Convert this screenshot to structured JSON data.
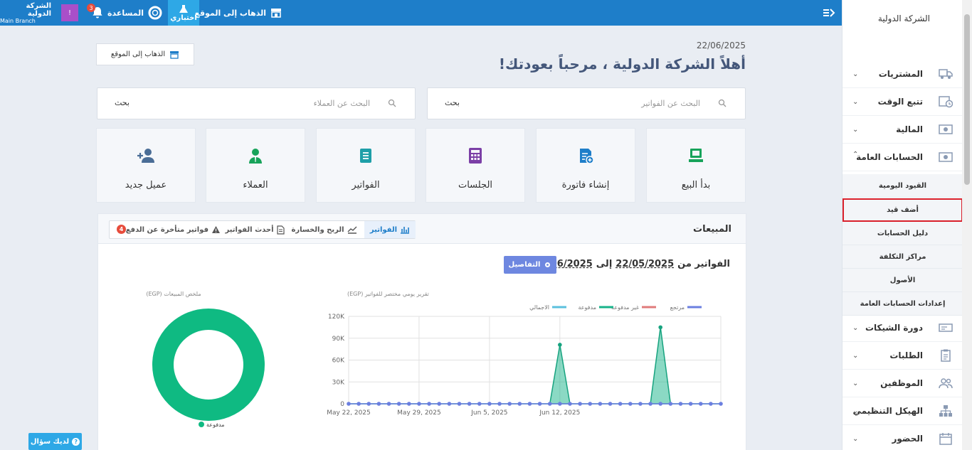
{
  "topbar": {
    "company_name": "الشركة الدولية",
    "branch": "Main Branch",
    "user_badge": "!",
    "notification_count": "3",
    "help_label": "المساعدة",
    "test_label": "اختباري",
    "go_to_site_label": "الذهاب إلى الموقع"
  },
  "sidebar": {
    "company": "الشركة الدولية",
    "items": [
      {
        "label": "المشتريات",
        "icon": "truck-icon"
      },
      {
        "label": "تتبع الوقت",
        "icon": "clock-calendar-icon"
      },
      {
        "label": "المالية",
        "icon": "money-icon"
      },
      {
        "label": "الحسابات العامة",
        "icon": "money-icon"
      }
    ],
    "subitems": [
      {
        "label": "القيود اليومية"
      },
      {
        "label": "أضف قيد"
      },
      {
        "label": "دليل الحسابات"
      },
      {
        "label": "مراكز التكلفة"
      },
      {
        "label": "الأصول"
      },
      {
        "label": "إعدادات الحسابات العامة"
      }
    ],
    "items_bottom": [
      {
        "label": "دورة الشيكات",
        "icon": "check-icon"
      },
      {
        "label": "الطلبات",
        "icon": "clipboard-icon"
      },
      {
        "label": "الموظفين",
        "icon": "users-icon"
      },
      {
        "label": "الهيكل التنظيمي",
        "icon": "sitemap-icon"
      },
      {
        "label": "الحضور",
        "icon": "calendar-icon"
      }
    ]
  },
  "header": {
    "date": "22/06/2025",
    "welcome": "أهلاً الشركة الدولية ، مرحباً بعودتك!",
    "go_to_site_button": "الذهاب إلى الموقع"
  },
  "search": {
    "invoices_placeholder": "البحث عن الفواتير",
    "clients_placeholder": "البحث عن العملاء",
    "search_button": "بحث"
  },
  "tiles": [
    {
      "label": "بدأ البيع",
      "icon": "pos-icon",
      "color": "#17a35a"
    },
    {
      "label": "إنشاء فاتورة",
      "icon": "add-invoice-icon",
      "color": "#1e7ec9"
    },
    {
      "label": "الجلسات",
      "icon": "calculator-icon",
      "color": "#7b3fa6"
    },
    {
      "label": "الفواتير",
      "icon": "invoice-icon",
      "color": "#1e9fa8"
    },
    {
      "label": "العملاء",
      "icon": "client-icon",
      "color": "#17a35a"
    },
    {
      "label": "عميل جديد",
      "icon": "add-user-icon",
      "color": "#4a6d96"
    }
  ],
  "sales": {
    "title": "المبيعات",
    "tabs": [
      {
        "label": "الفواتير",
        "icon": "bar-chart-icon",
        "active": true
      },
      {
        "label": "الربح والخسارة",
        "icon": "line-chart-icon",
        "active": false
      },
      {
        "label": "أحدث الفواتير",
        "icon": "document-icon",
        "active": false
      },
      {
        "label": "فواتير متأخرة عن الدفع",
        "icon": "warning-icon",
        "active": false,
        "badge": "4"
      }
    ],
    "range_title": "الفواتير من",
    "range_from": "22/05/2025",
    "range_to_word": "إلى",
    "range_to": "22/06/2025",
    "details_button": "التفاصيل"
  },
  "chart_data": [
    {
      "type": "line",
      "title": "(EGP) تقرير يومي مختصر للفواتير",
      "legend": [
        "مرتجع",
        "غير مدفوعة",
        "مدفوعة",
        "الاجمالي"
      ],
      "legend_colors": [
        "#6b7fe0",
        "#e07b7b",
        "#17b38a",
        "#5bc0de"
      ],
      "y_ticks": [
        "0",
        "30K",
        "60K",
        "90K",
        "120K"
      ],
      "x_ticks": [
        "May 22, 2025",
        "May 29, 2025",
        "Jun 5, 2025",
        "Jun 12, 2025"
      ],
      "ylim": [
        0,
        120000
      ],
      "series": [
        {
          "name": "مدفوعة",
          "points": [
            [
              0,
              0
            ],
            [
              1,
              0
            ],
            [
              2,
              0
            ],
            [
              3,
              0
            ],
            [
              4,
              0
            ],
            [
              5,
              0
            ],
            [
              6,
              0
            ],
            [
              7,
              0
            ],
            [
              8,
              0
            ],
            [
              9,
              0
            ],
            [
              10,
              0
            ],
            [
              11,
              0
            ],
            [
              12,
              0
            ],
            [
              13,
              0
            ],
            [
              14,
              0
            ],
            [
              15,
              0
            ],
            [
              16,
              0
            ],
            [
              17,
              0
            ],
            [
              18,
              0
            ],
            [
              19,
              0
            ],
            [
              20,
              0
            ],
            [
              21,
              81000
            ],
            [
              22,
              0
            ],
            [
              23,
              0
            ],
            [
              24,
              0
            ],
            [
              25,
              0
            ],
            [
              26,
              0
            ],
            [
              27,
              0
            ],
            [
              28,
              0
            ],
            [
              29,
              0
            ],
            [
              30,
              0
            ],
            [
              31,
              105000
            ],
            [
              32,
              0
            ],
            [
              33,
              0
            ],
            [
              34,
              0
            ],
            [
              35,
              0
            ],
            [
              36,
              0
            ],
            [
              37,
              0
            ]
          ]
        },
        {
          "name": "مرتجع",
          "points": [
            [
              0,
              0
            ],
            [
              1,
              0
            ],
            [
              2,
              0
            ],
            [
              3,
              0
            ],
            [
              4,
              0
            ],
            [
              5,
              0
            ],
            [
              6,
              0
            ],
            [
              7,
              0
            ],
            [
              8,
              0
            ],
            [
              9,
              0
            ],
            [
              10,
              0
            ],
            [
              11,
              0
            ],
            [
              12,
              0
            ],
            [
              13,
              0
            ],
            [
              14,
              0
            ],
            [
              15,
              0
            ],
            [
              16,
              0
            ],
            [
              17,
              0
            ],
            [
              18,
              0
            ],
            [
              19,
              0
            ],
            [
              20,
              0
            ],
            [
              21,
              0
            ],
            [
              22,
              0
            ],
            [
              23,
              0
            ],
            [
              24,
              0
            ],
            [
              25,
              0
            ],
            [
              26,
              0
            ],
            [
              27,
              0
            ],
            [
              28,
              0
            ],
            [
              29,
              0
            ],
            [
              30,
              0
            ],
            [
              31,
              0
            ],
            [
              32,
              0
            ],
            [
              33,
              0
            ],
            [
              34,
              0
            ],
            [
              35,
              0
            ],
            [
              36,
              0
            ],
            [
              37,
              0
            ]
          ]
        }
      ]
    },
    {
      "type": "pie",
      "title": "(EGP) ملخص المبيعات",
      "slices": [
        {
          "name": "مدفوعة",
          "value": 100,
          "color": "#0fba82"
        }
      ]
    }
  ],
  "help_button": "لديك سؤال"
}
